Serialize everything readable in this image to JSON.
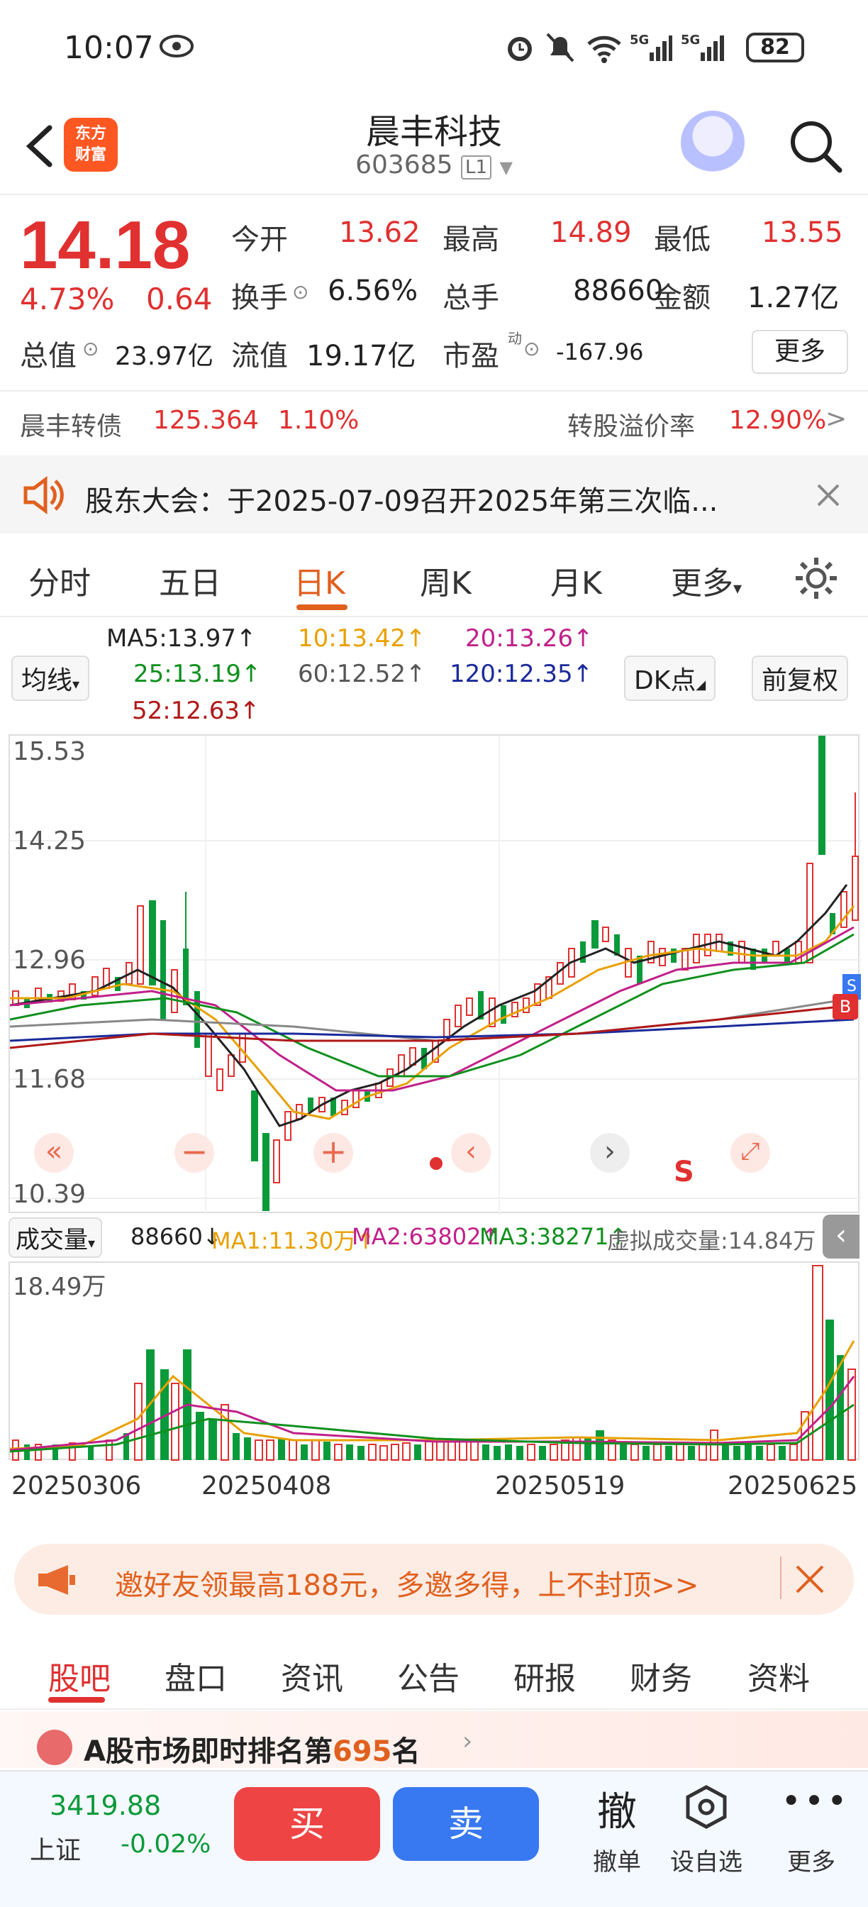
{
  "status_bar": {
    "time": "10:07",
    "battery": "82"
  },
  "header": {
    "logo_text": "东方\n财富",
    "stock_name": "晨丰科技",
    "stock_code": "603685",
    "level_badge": "L1"
  },
  "quote": {
    "price": "14.18",
    "pct": "4.73%",
    "change": "0.64",
    "open_label": "今开",
    "open": "13.62",
    "high_label": "最高",
    "high": "14.89",
    "low_label": "最低",
    "low": "13.55",
    "turnover_label": "换手",
    "turnover": "6.56%",
    "volume_label": "总手",
    "volume": "88660",
    "amount_label": "金额",
    "amount": "1.27亿",
    "mktcap_label": "总值",
    "mktcap": "23.97亿",
    "float_label": "流值",
    "float": "19.17亿",
    "pe_label": "市盈",
    "pe_sup": "动",
    "pe": "-167.96",
    "more": "更多"
  },
  "bond": {
    "name": "晨丰转债",
    "price": "125.364",
    "pct": "1.10%",
    "premium_label": "转股溢价率",
    "premium": "12.90%"
  },
  "notice": {
    "text": "股东大会：于2025-07-09召开2025年第三次临..."
  },
  "periods": [
    "分时",
    "五日",
    "日K",
    "周K",
    "月K",
    "更多"
  ],
  "active_period": "日K",
  "ma": {
    "selector": "均线",
    "ma5": "MA5:13.97↑",
    "ma10": "10:13.42↑",
    "ma20": "20:13.26↑",
    "ma25": "25:13.19↑",
    "ma60": "60:12.52↑",
    "ma120": "120:12.35↑",
    "ma52": "52:12.63↑",
    "dk": "DK点",
    "adjust": "前复权"
  },
  "kline": {
    "y_labels": [
      "15.53",
      "14.25",
      "12.96",
      "11.68",
      "10.39"
    ],
    "s_marker": "S",
    "b_marker": "B"
  },
  "vol_header": {
    "selector": "成交量",
    "vol": "88660↓",
    "ma1": "MA1:11.30万↑",
    "ma2": "MA2:63802↑",
    "ma3": "MA3:38271↑",
    "virtual": "虚拟成交量:14.84万"
  },
  "volume": {
    "max_label": "18.49万"
  },
  "dates": [
    "20250306",
    "20250408",
    "20250519",
    "20250625"
  ],
  "promo": {
    "text": "邀好友领最高188元，多邀多得，上不封顶>>"
  },
  "tabs2": [
    "股吧",
    "盘口",
    "资讯",
    "公告",
    "研报",
    "财务",
    "资料"
  ],
  "active_tab2": "股吧",
  "rank": {
    "prefix": "A股市场即时排名第",
    "rank": "695",
    "suffix": "名"
  },
  "bottombar": {
    "index_value": "3419.88",
    "index_name": "上证",
    "index_change": "-0.02%",
    "buy": "买",
    "sell": "卖",
    "cancel_icon_char": "撤",
    "cancel": "撤单",
    "watch": "设自选",
    "more": "更多"
  },
  "colors": {
    "up": "#e03030",
    "down": "#0a9a3a",
    "accent": "#e0601e",
    "buy": "#ee4444",
    "sell": "#3878f0"
  }
}
